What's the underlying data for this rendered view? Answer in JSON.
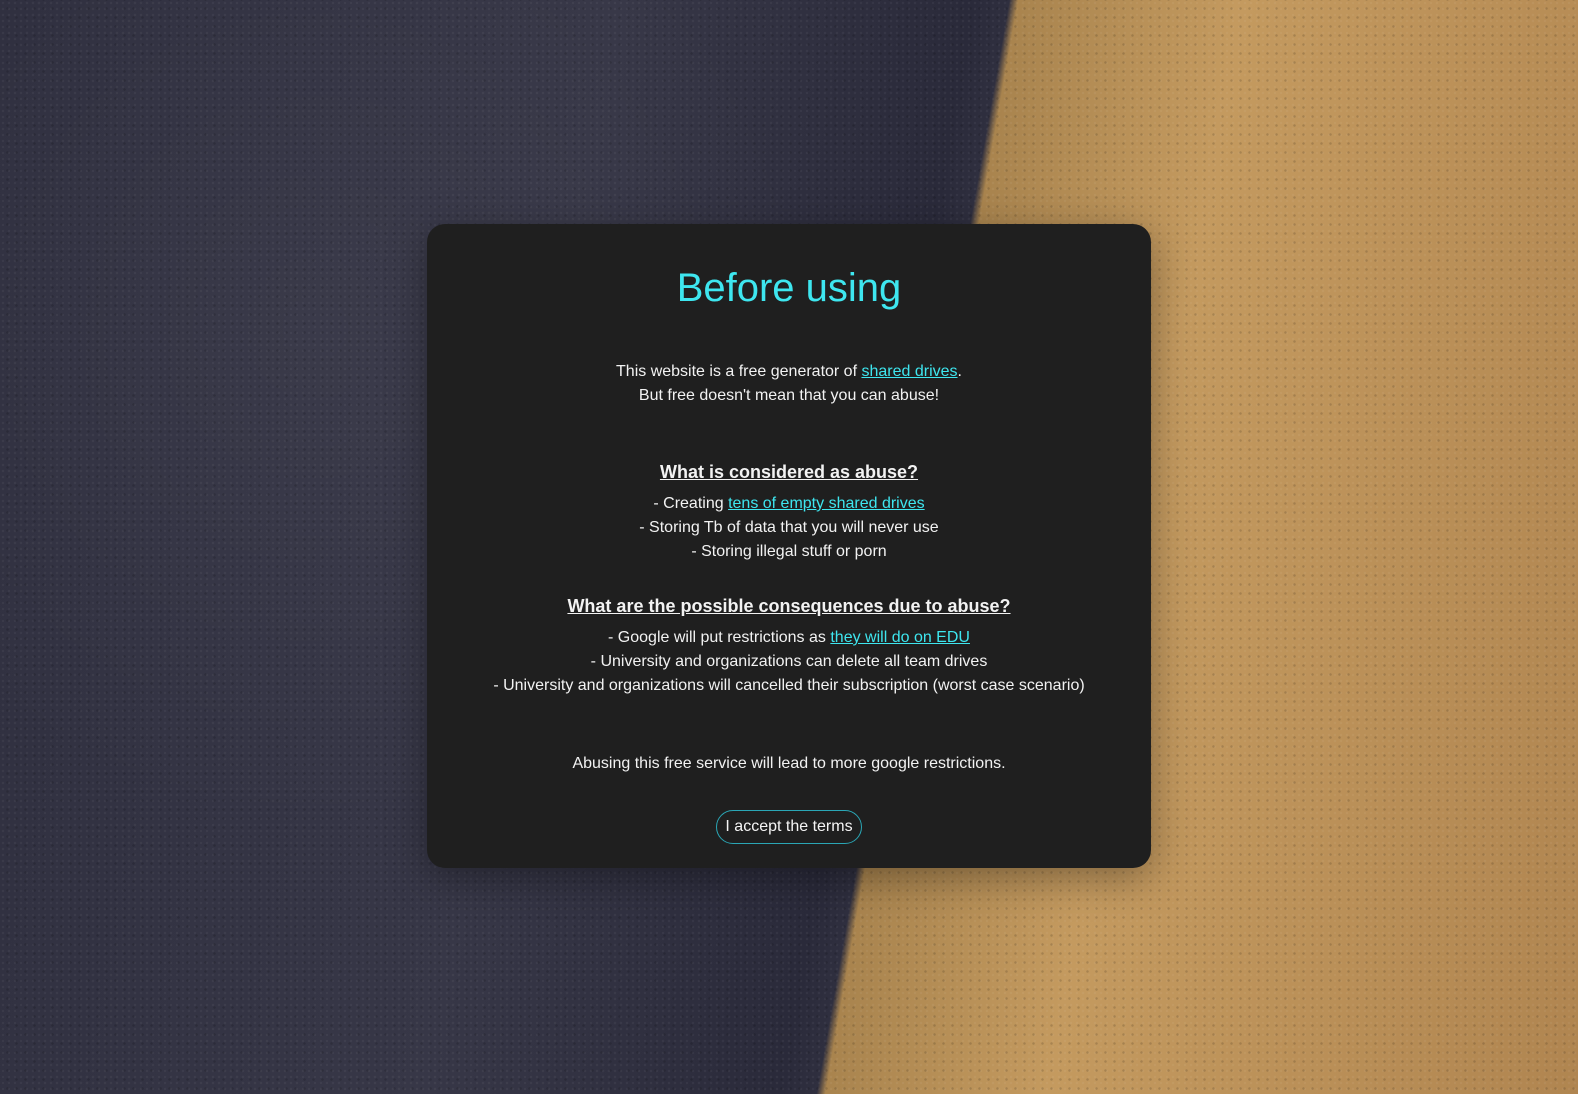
{
  "modal": {
    "title": "Before using",
    "intro": {
      "line1_prefix": "This website is a free generator of ",
      "line1_link": "shared drives",
      "line1_suffix": ".",
      "line2": "But free doesn't mean that you can abuse!"
    },
    "abuse_section": {
      "heading": "What is considered as abuse?",
      "item1_prefix": "- Creating ",
      "item1_link": "tens of empty shared drives",
      "item2": "- Storing Tb of data that you will never use",
      "item3": "- Storing illegal stuff or porn"
    },
    "consequences_section": {
      "heading": "What are the possible consequences due to abuse?",
      "item1_prefix": "- Google will put restrictions as ",
      "item1_link": "they will do on EDU",
      "item2": "- University and organizations can delete all team drives",
      "item3": "- University and organizations will cancelled their subscription (worst case scenario)"
    },
    "footer_text": "Abusing this free service will lead to more google restrictions.",
    "accept_button": "I accept the terms"
  },
  "colors": {
    "accent": "#3ee6ef",
    "modal_bg": "#1f1f1f",
    "button_border": "#2aa6b5"
  }
}
